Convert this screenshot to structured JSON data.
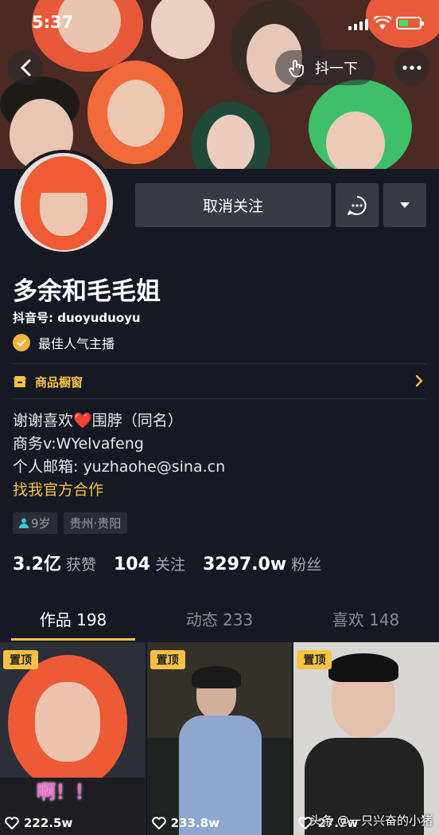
{
  "status_bar": {
    "time": "5:37"
  },
  "header": {
    "shake_label": "抖一下"
  },
  "actions": {
    "unfollow_label": "取消关注"
  },
  "profile": {
    "name": "多余和毛毛姐",
    "douyin_id": "抖音号: duoyuduoyu",
    "award": "最佳人气主播",
    "shop_label": "商品橱窗",
    "bio_line1_a": "谢谢喜欢",
    "bio_line1_heart": "❤️",
    "bio_line1_b": "围脖（同名）",
    "bio_line2": "商务v:WYelvafeng",
    "bio_line3": "个人邮箱:  yuzhaohe@sina.cn",
    "bio_link": "找我官方合作",
    "tag_age": "9岁",
    "tag_location": "贵州·贵阳"
  },
  "stats": {
    "likes_value": "3.2亿",
    "likes_label": "获赞",
    "following_value": "104",
    "following_label": "关注",
    "fans_value": "3297.0w",
    "fans_label": "粉丝"
  },
  "tabs": [
    {
      "label": "作品 198"
    },
    {
      "label": "动态 233"
    },
    {
      "label": "喜欢 148"
    }
  ],
  "videos": [
    {
      "pin": "置顶",
      "likes": "222.5w",
      "overlay": "啊！！"
    },
    {
      "pin": "置顶",
      "likes": "233.8w"
    },
    {
      "pin": "置顶",
      "likes": "27.7w",
      "watermark": "头条 @一只兴奋的小猪"
    }
  ],
  "colors": {
    "accent": "#f7c244",
    "background": "#161823",
    "button": "#393b44"
  }
}
